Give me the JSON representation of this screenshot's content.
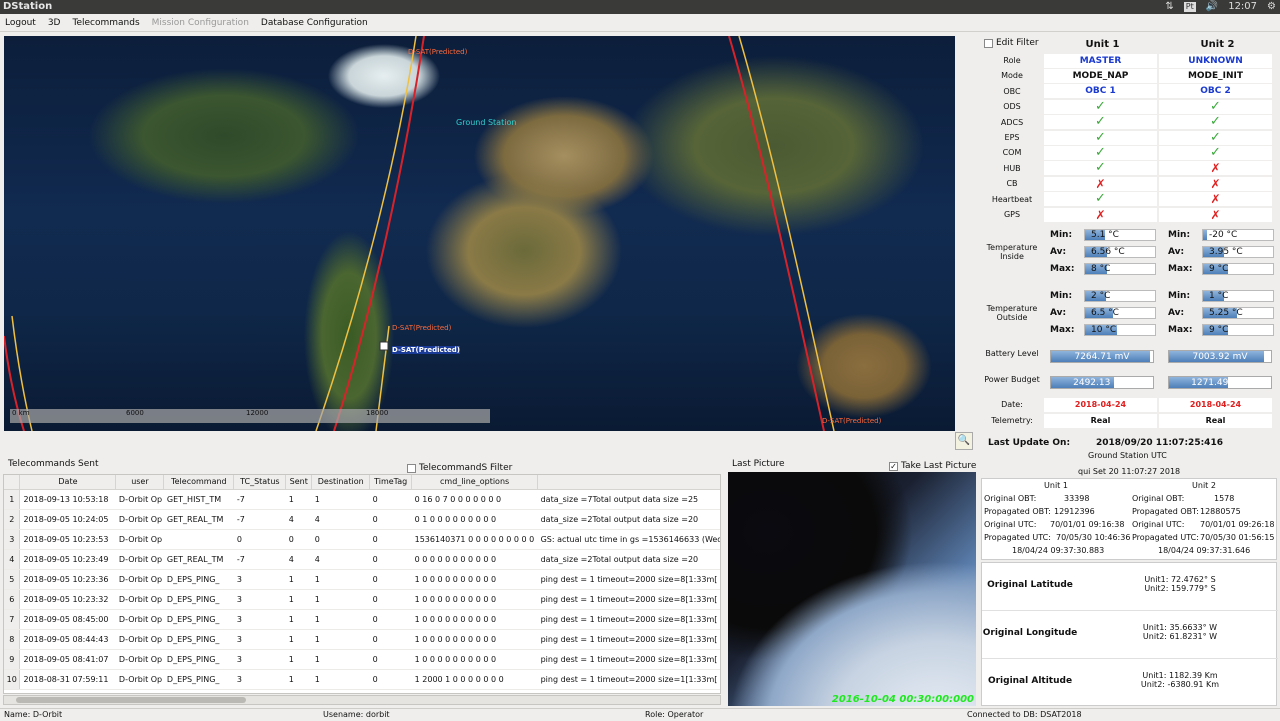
{
  "window": {
    "title": "DStation",
    "clock": "12:07",
    "kb": "Pt"
  },
  "menu": [
    "Logout",
    "3D",
    "Telecommands",
    "Mission Configuration",
    "Database Configuration"
  ],
  "map": {
    "ground_station": "Ground Station",
    "sat_labels": [
      "D-SAT(Predicted)",
      "D-SAT(Predicted)",
      "D-SAT(Predicted)",
      "D-SAT(Predicted)"
    ],
    "scale": [
      "0 km",
      "6000",
      "12000",
      "18000"
    ]
  },
  "panel": {
    "edit_filter": "Edit Filter",
    "unit1": "Unit 1",
    "unit2": "Unit 2",
    "rows": [
      {
        "label": "Role",
        "u1": "MASTER",
        "u2": "UNKNOWN",
        "kind": "text",
        "color": "blue"
      },
      {
        "label": "Mode",
        "u1": "MODE_NAP",
        "u2": "MODE_INIT",
        "kind": "text",
        "color": "black"
      },
      {
        "label": "OBC",
        "u1": "OBC 1",
        "u2": "OBC 2",
        "kind": "text",
        "color": "blue"
      },
      {
        "label": "ODS",
        "u1": "ok",
        "u2": "ok",
        "kind": "status"
      },
      {
        "label": "ADCS",
        "u1": "ok",
        "u2": "ok",
        "kind": "status"
      },
      {
        "label": "EPS",
        "u1": "ok",
        "u2": "ok",
        "kind": "status"
      },
      {
        "label": "COM",
        "u1": "ok",
        "u2": "ok",
        "kind": "status"
      },
      {
        "label": "HUB",
        "u1": "ok",
        "u2": "fail",
        "kind": "status"
      },
      {
        "label": "CB",
        "u1": "fail",
        "u2": "fail",
        "kind": "status"
      },
      {
        "label": "Heartbeat",
        "u1": "ok",
        "u2": "fail",
        "kind": "status"
      },
      {
        "label": "GPS",
        "u1": "fail",
        "u2": "fail",
        "kind": "status"
      }
    ],
    "temp_inside": {
      "label": "Temperature Inside",
      "u1": {
        "min": "5.1 °C",
        "av": "6.56 °C",
        "max": "8 °C",
        "fmin": 0.28,
        "fav": 0.32,
        "fmax": 0.32
      },
      "u2": {
        "min": "-20 °C",
        "av": "3.95 °C",
        "max": "9 °C",
        "fmin": 0.05,
        "fav": 0.3,
        "fmax": 0.35
      }
    },
    "temp_outside": {
      "label": "Temperature Outside",
      "u1": {
        "min": "2 °C",
        "av": "6.5 °C",
        "max": "10 °C",
        "fmin": 0.3,
        "fav": 0.4,
        "fmax": 0.45
      },
      "u2": {
        "min": "1 °C",
        "av": "5.25 °C",
        "max": "9 °C",
        "fmin": 0.3,
        "fav": 0.48,
        "fmax": 0.35
      }
    },
    "min_label": "Min:",
    "av_label": "Av:",
    "max_label": "Max:",
    "battery": {
      "label": "Battery Level",
      "u1": "7264.71 mV",
      "u2": "7003.92 mV",
      "f1": 0.97,
      "f2": 0.93
    },
    "power": {
      "label": "Power Budget",
      "u1": "2492.13 mW",
      "u2": "1271.49 mW",
      "f1": 0.62,
      "f2": 0.58
    },
    "date": {
      "label": "Date:",
      "u1": "2018-04-24 09:37:30.883",
      "u2": "2018-04-24 09:37:31.646"
    },
    "telemetry": {
      "label": "Telemetry:",
      "u1": "Real",
      "u2": "Real"
    }
  },
  "telecommands": {
    "title": "Telecommands Sent",
    "filter_label": "TelecommandS Filter",
    "columns": [
      "",
      "Date",
      "user",
      "Telecommand",
      "TC_Status",
      "Sent",
      "Destination",
      "TimeTag",
      "cmd_line_options",
      ""
    ],
    "rows": [
      [
        "1",
        "2018-09-13 10:53:18",
        "D-Orbit Op",
        "GET_HIST_TM",
        "-7",
        "1",
        "1",
        "0",
        "0 16 0 7 0 0 0 0 0 0 0",
        "data_size =7Total output data size =25"
      ],
      [
        "2",
        "2018-09-05 10:24:05",
        "D-Orbit Op",
        "GET_REAL_TM",
        "-7",
        "4",
        "4",
        "0",
        "0 1 0 0 0 0 0 0 0 0 0",
        "data_size =2Total output data size =20"
      ],
      [
        "3",
        "2018-09-05 10:23:53",
        "D-Orbit Op",
        "",
        "0",
        "0",
        "0",
        "0",
        "1536140371 0 0 0 0 0 0 0 0 0",
        "GS: actual utc time in gs =1536146633 (Wed"
      ],
      [
        "4",
        "2018-09-05 10:23:49",
        "D-Orbit Op",
        "GET_REAL_TM",
        "-7",
        "4",
        "4",
        "0",
        "0 0 0 0 0 0 0 0 0 0 0",
        "data_size =2Total output data size =20"
      ],
      [
        "5",
        "2018-09-05 10:23:36",
        "D-Orbit Op",
        "D_EPS_PING_",
        "3",
        "1",
        "1",
        "0",
        "1 0 0 0 0 0 0 0 0 0 0",
        "ping dest = 1 timeout=2000 size=8[1:33m["
      ],
      [
        "6",
        "2018-09-05 10:23:32",
        "D-Orbit Op",
        "D_EPS_PING_",
        "3",
        "1",
        "1",
        "0",
        "1 0 0 0 0 0 0 0 0 0 0",
        "ping dest = 1 timeout=2000 size=8[1:33m["
      ],
      [
        "7",
        "2018-09-05 08:45:00",
        "D-Orbit Op",
        "D_EPS_PING_",
        "3",
        "1",
        "1",
        "0",
        "1 0 0 0 0 0 0 0 0 0 0",
        "ping dest = 1 timeout=2000 size=8[1:33m["
      ],
      [
        "8",
        "2018-09-05 08:44:43",
        "D-Orbit Op",
        "D_EPS_PING_",
        "3",
        "1",
        "1",
        "0",
        "1 0 0 0 0 0 0 0 0 0 0",
        "ping dest = 1 timeout=2000 size=8[1:33m["
      ],
      [
        "9",
        "2018-09-05 08:41:07",
        "D-Orbit Op",
        "D_EPS_PING_",
        "3",
        "1",
        "1",
        "0",
        "1 0 0 0 0 0 0 0 0 0 0",
        "ping dest = 1 timeout=2000 size=8[1:33m["
      ],
      [
        "10",
        "2018-08-31 07:59:11",
        "D-Orbit Op",
        "D_EPS_PING_",
        "3",
        "1",
        "1",
        "0",
        "1 2000 1 0 0 0 0 0 0 0",
        "ping dest = 1 timeout=2000 size=1[1:33m["
      ]
    ]
  },
  "picture": {
    "title": "Last Picture",
    "take_label": "Take Last Picture",
    "stamp": "2016-10-04 00:30:00:000"
  },
  "update": {
    "label": "Last Update On:",
    "value": "2018/09/20 11:07:25:416",
    "gs_label": "Ground Station UTC",
    "gs_value": "qui Set 20 11:07:27 2018"
  },
  "obt": {
    "unit1": "Unit 1",
    "unit2": "Unit 2",
    "u1": {
      "orig_obt": "33398",
      "prop_obt": "12912396",
      "orig_utc": "70/01/01 09:16:38",
      "prop_utc": "70/05/30 10:46:36",
      "date": "18/04/24 09:37:30.883"
    },
    "u2": {
      "orig_obt": "1578",
      "prop_obt": "12880575",
      "orig_utc": "70/01/01 09:26:18",
      "prop_utc": "70/05/30 01:56:15",
      "date": "18/04/24 09:37:31.646"
    },
    "labels": {
      "orig_obt": "Original OBT:",
      "prop_obt": "Propagated OBT:",
      "orig_utc": "Original UTC:",
      "prop_utc": "Propagated UTC:"
    }
  },
  "position": [
    {
      "label": "Original Latitude",
      "u1": "Unit1: 72.4762° S",
      "u2": "Unit2: 159.779° S"
    },
    {
      "label": "Original Longitude",
      "u1": "Unit1: 35.6633° W",
      "u2": "Unit2: 61.8231° W"
    },
    {
      "label": "Original Altitude",
      "u1": "Unit1: 1182.39 Km",
      "u2": "Unit2: -6380.91 Km"
    }
  ],
  "statusbar": {
    "name": "Name: D-Orbit",
    "user": "Usename: dorbit",
    "role": "Role: Operator",
    "db": "Connected to DB: DSAT2018"
  }
}
